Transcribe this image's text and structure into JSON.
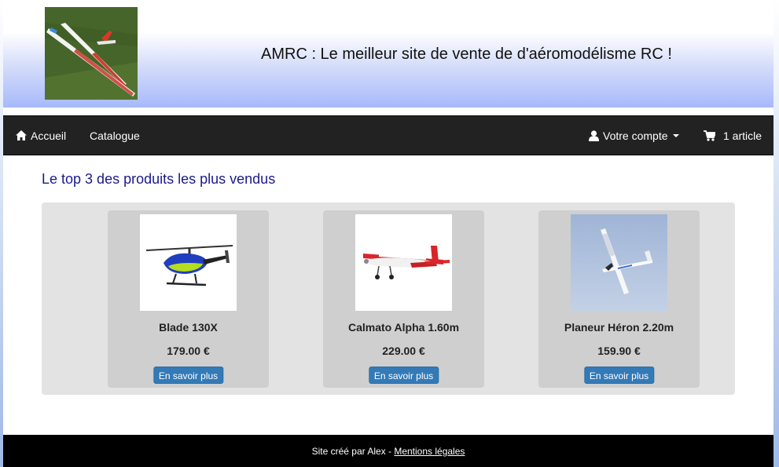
{
  "header": {
    "site_title": "AMRC : Le meilleur site de vente de d'aéromodélisme RC !",
    "logo_icon": "glider-logo-photo"
  },
  "navbar": {
    "home_label": "Accueil",
    "home_icon": "home-icon",
    "catalog_label": "Catalogue",
    "account_label": "Votre compte",
    "account_icon": "user-icon",
    "cart_label": "1 article",
    "cart_icon": "shopping-cart-icon"
  },
  "main": {
    "section_title": "Le top 3 des produits les plus vendus",
    "products": [
      {
        "name": "Blade 130X",
        "price": "179.00 €",
        "button": "En savoir plus",
        "image_icon": "helicopter-image"
      },
      {
        "name": "Calmato Alpha 1.60m",
        "price": "229.00 €",
        "button": "En savoir plus",
        "image_icon": "airplane-image"
      },
      {
        "name": "Planeur Héron 2.20m",
        "price": "159.90 €",
        "button": "En savoir plus",
        "image_icon": "glider-image"
      }
    ]
  },
  "footer": {
    "text": "Site créé par Alex - ",
    "link_label": "Mentions légales"
  },
  "colors": {
    "navbar_bg": "#222222",
    "button_bg": "#337ab7",
    "section_title": "#1a1a8c",
    "footer_bg": "#000000"
  }
}
